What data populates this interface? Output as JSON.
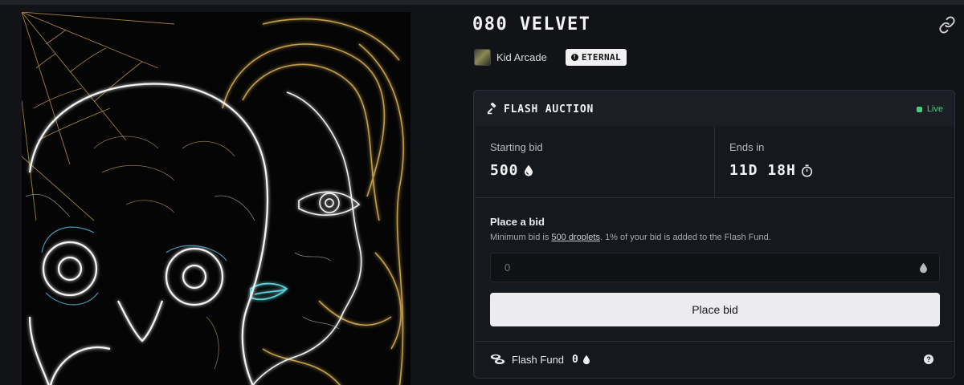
{
  "artwork": {
    "alt": ""
  },
  "header": {
    "title": "080 VELVET",
    "creator_name": "Kid Arcade",
    "badge_label": "ETERNAL",
    "link_icon": "link-icon"
  },
  "auction": {
    "title": "FLASH AUCTION",
    "status": "Live",
    "status_color": "#37d67a",
    "starting_bid_label": "Starting bid",
    "starting_bid_value": "500",
    "ends_in_label": "Ends in",
    "ends_in_value": "11D 18H",
    "place_bid_label": "Place a bid",
    "hint_prefix": "Minimum bid is ",
    "hint_link": "500 droplets",
    "hint_suffix": ". 1% of your bid is added to the Flash Fund.",
    "input_value": "",
    "input_placeholder": "0",
    "button_label": "Place bid",
    "fund_label": "Flash Fund",
    "fund_value": "0",
    "help_glyph": "?"
  }
}
